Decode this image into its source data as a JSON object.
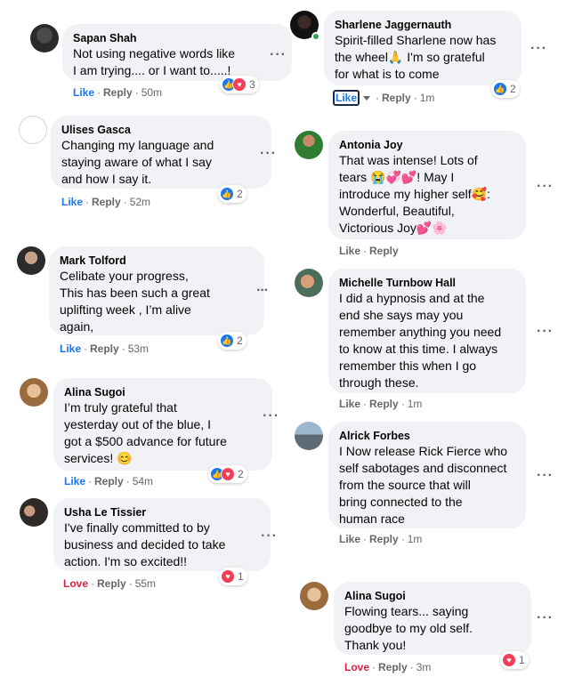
{
  "comments": [
    {
      "author": "Sapan Shah",
      "text": "Not using negative words like\nI am trying.... or I want to.....!",
      "like": "Like",
      "reply": "Reply",
      "time": "50m",
      "reactions": [
        "like",
        "love"
      ],
      "count": "3",
      "avatar": "av-sapan"
    },
    {
      "author": "Sharlene Jaggernauth",
      "text": "Spirit-filled Sharlene now has\nthe wheel🙏 I'm so grateful\nfor what is to come",
      "like": "Like",
      "reply": "Reply",
      "time": "1m",
      "reactions": [
        "like"
      ],
      "count": "2",
      "avatar": "av-sharlene"
    },
    {
      "author": "Ulises Gasca",
      "text": "Changing my language and\nstaying aware of what I say\nand how I say it.",
      "like": "Like",
      "reply": "Reply",
      "time": "52m",
      "reactions": [
        "like"
      ],
      "count": "2",
      "avatar": "av-ulises"
    },
    {
      "author": "Antonia Joy",
      "text": "That was intense! Lots of\ntears 😭💞💕! May I\nintroduce my higher self🥰:\nWonderful, Beautiful,\nVictorious Joy💕🌸",
      "like": "Like",
      "reply": "Reply",
      "time": "",
      "reactions": [],
      "count": "",
      "avatar": "av-antonia"
    },
    {
      "author": "Mark Tolford",
      "text": "Celibate your progress,\nThis has been such a great\nuplifting week , I’m alive\nagain,",
      "like": "Like",
      "reply": "Reply",
      "time": "53m",
      "reactions": [
        "like"
      ],
      "count": "2",
      "avatar": "av-mark"
    },
    {
      "author": "Michelle Turnbow Hall",
      "text": "I did a hypnosis and at the\nend she says may you\nremember anything you need\nto know at this time. I always\nremember this when I go\nthrough these.",
      "like": "Like",
      "reply": "Reply",
      "time": "1m",
      "reactions": [],
      "count": "",
      "avatar": "av-michelle"
    },
    {
      "author": "Alina Sugoi",
      "text": "I’m truly grateful that\nyesterday out of the blue, I\ngot a $500 advance for future\nservices! 😊",
      "like": "Like",
      "reply": "Reply",
      "time": "54m",
      "reactions": [
        "like",
        "love"
      ],
      "count": "2",
      "avatar": "av-alina"
    },
    {
      "author": "Alrick Forbes",
      "text": "I Now release Rick Fierce who\nself sabotages and disconnect\nfrom the source that will\nbring connected to the\nhuman race",
      "like": "Like",
      "reply": "Reply",
      "time": "1m",
      "reactions": [],
      "count": "",
      "avatar": "av-alrick"
    },
    {
      "author": "Usha Le Tissier",
      "text": "I've finally committed to by\nbusiness and decided to take\naction. I'm so excited!!",
      "like": "Love",
      "reply": "Reply",
      "time": "55m",
      "reactions": [
        "love"
      ],
      "count": "1",
      "avatar": "av-usha"
    },
    {
      "author": "Alina Sugoi",
      "text": "Flowing tears... saying\ngoodbye to my old self.\nThank you!",
      "like": "Love",
      "reply": "Reply",
      "time": "3m",
      "reactions": [
        "love"
      ],
      "count": "1",
      "avatar": "av-alina"
    }
  ],
  "ui": {
    "more": "···",
    "separator": "·"
  }
}
